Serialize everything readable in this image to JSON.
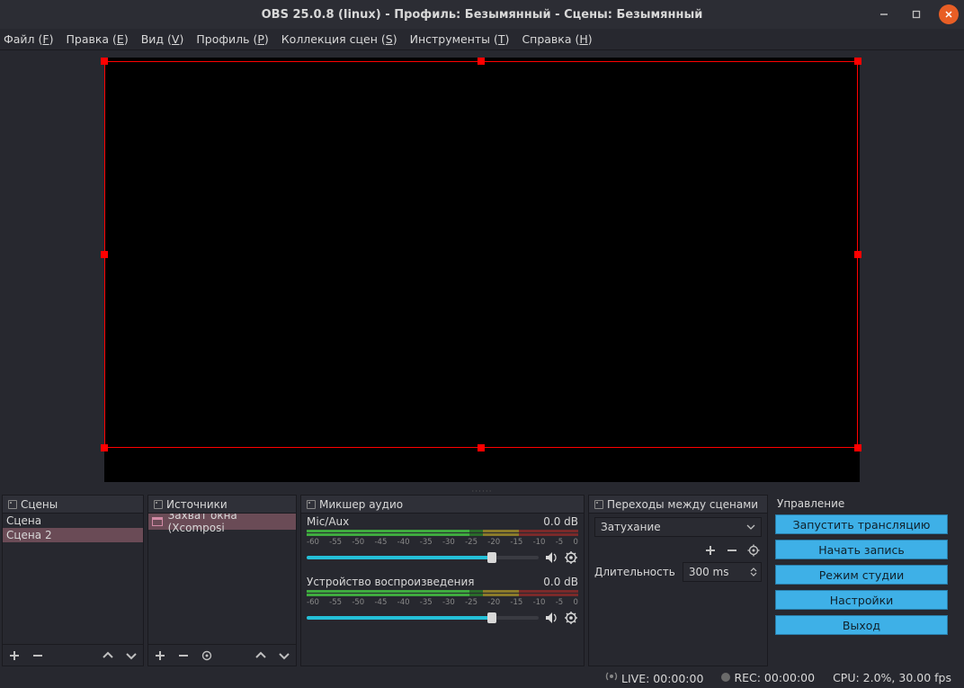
{
  "title": "OBS 25.0.8 (linux) - Профиль: Безымянный - Сцены: Безымянный",
  "menu": {
    "file": {
      "pre": "Файл (",
      "u": "F",
      "post": ")"
    },
    "edit": {
      "pre": "Правка (",
      "u": "E",
      "post": ")"
    },
    "view": {
      "pre": "Вид (",
      "u": "V",
      "post": ")"
    },
    "profile": {
      "pre": "Профиль (",
      "u": "P",
      "post": ")"
    },
    "scenecol": {
      "pre": "Коллекция сцен (",
      "u": "S",
      "post": ")"
    },
    "tools": {
      "pre": "Инструменты (",
      "u": "T",
      "post": ")"
    },
    "help": {
      "pre": "Справка (",
      "u": "H",
      "post": ")"
    }
  },
  "scenes": {
    "title": "Сцены",
    "items": [
      "Сцена",
      "Сцена 2"
    ],
    "selected": 1
  },
  "sources": {
    "title": "Источники",
    "items": [
      "Захват окна (Xcomposi"
    ]
  },
  "mixer": {
    "title": "Микшер аудио",
    "channels": [
      {
        "name": "Mic/Aux",
        "db": "0.0 dB",
        "ticks": [
          "-60",
          "-55",
          "-50",
          "-45",
          "-40",
          "-35",
          "-30",
          "-25",
          "-20",
          "-15",
          "-10",
          "-5",
          "0"
        ],
        "fill_pct": 80
      },
      {
        "name": "Устройство воспроизведения",
        "db": "0.0 dB",
        "ticks": [
          "-60",
          "-55",
          "-50",
          "-45",
          "-40",
          "-35",
          "-30",
          "-25",
          "-20",
          "-15",
          "-10",
          "-5",
          "0"
        ],
        "fill_pct": 80
      }
    ]
  },
  "transitions": {
    "title": "Переходы между сценами",
    "selected": "Затухание",
    "duration_label": "Длительность",
    "duration_value": "300 ms"
  },
  "controls": {
    "title": "Управление",
    "buttons": [
      "Запустить трансляцию",
      "Начать запись",
      "Режим студии",
      "Настройки",
      "Выход"
    ]
  },
  "status": {
    "live": "LIVE: 00:00:00",
    "rec": "REC: 00:00:00",
    "cpu": "CPU: 2.0%, 30.00 fps"
  }
}
